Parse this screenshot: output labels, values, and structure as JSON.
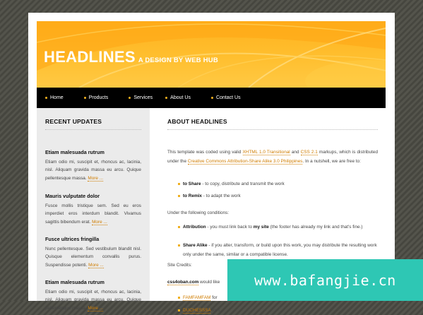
{
  "header": {
    "title": "HEADLINES",
    "tagline": "A DESIGN BY WEB HUB",
    "brand_color": "#ffb21e"
  },
  "nav": {
    "items": [
      "Home",
      "Products",
      "Services",
      "About Us",
      "Contact Us"
    ]
  },
  "sidebar": {
    "heading": "RECENT UPDATES",
    "more_label": "More ...",
    "items": [
      {
        "title": "Etiam malesuada rutrum",
        "body": "Etiam odio mi, suscipit et, rhoncus ac, lacinia, nisl. Aliquam gravida massa eu arcu. Quique pellentesque massa."
      },
      {
        "title": "Mauris vulputate dolor",
        "body": "Fusce mollis tristique sem. Sed eu eros imperdiet eros interdum blandit. Vivamus sagittis bibendum erat."
      },
      {
        "title": "Fusce ultrices fringilla",
        "body": "Nunc pellentesque. Sed vestibulum blandit nisl. Quisque elementum convallis purus. Suspendisse potenti."
      },
      {
        "title": "Etiam malesuada rutrum",
        "body": "Etiam odio mi, suscipit et, rhoncus ac, lacinia, nisl. Aliquam gravida massa eu arcu. Quique pellentesque massa."
      }
    ]
  },
  "main": {
    "heading": "ABOUT HEADLINES",
    "intro": {
      "t1": "This template was coded using valid ",
      "link1": "XHTML 1.0 Transitional",
      "t2": " and ",
      "link2": "CSS 2.1",
      "t3": " markups, which is distributed under the ",
      "link3": "Creative Commons Attribution-Share Alike 3.0 Philippines",
      "t4": ". In a nutshell, we are free to:"
    },
    "freedoms": [
      {
        "term": "to Share",
        "desc": " - to copy, distribute and transmit the work"
      },
      {
        "term": "to Remix",
        "desc": " - to adapt the work"
      }
    ],
    "conditions_intro": "Under the following conditions:",
    "conditions": [
      {
        "term": "Attribution",
        "d1": " - you must link back to ",
        "link": "my site",
        "d2": " (the footer has already my link and that's fine.)"
      },
      {
        "term": "Share Alike",
        "d1": " - if you alter, transform, or build upon this work, you may distribute the resulting work only under the same, similar or a compatible license.",
        "link": "",
        "d2": ""
      }
    ],
    "site_credits_label": "Site Credits:",
    "credit": {
      "name": "css4oban.com",
      "text": " would like"
    },
    "credit_items": [
      {
        "link": "FAMFAMFAM",
        "text": " for"
      },
      {
        "link": "DUCHESSSA",
        "text": " for t"
      }
    ]
  },
  "watermark": "www.bafangjie.cn"
}
